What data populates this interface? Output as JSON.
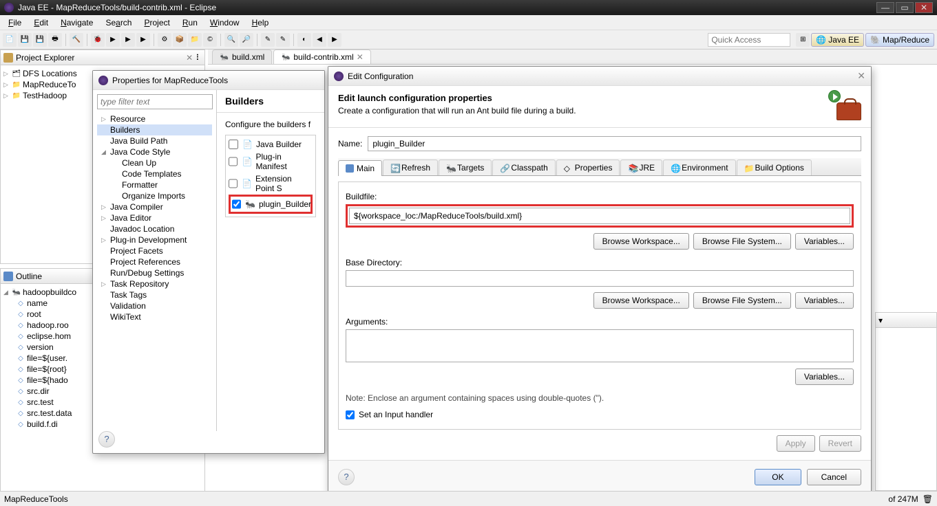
{
  "titlebar": {
    "text": "Java EE - MapReduceTools/build-contrib.xml - Eclipse"
  },
  "menu": {
    "file": "File",
    "edit": "Edit",
    "navigate": "Navigate",
    "search": "Search",
    "project": "Project",
    "run": "Run",
    "window": "Window",
    "help": "Help"
  },
  "quick_access": "Quick Access",
  "perspectives": {
    "java_ee": "Java EE",
    "mapreduce": "Map/Reduce"
  },
  "views": {
    "project_explorer": {
      "title": "Project Explorer",
      "items": [
        "DFS Locations",
        "MapReduceTo",
        "TestHadoop"
      ]
    },
    "outline": {
      "title": "Outline",
      "root": "hadoopbuildco",
      "items": [
        "name",
        "root",
        "hadoop.roo",
        "eclipse.hom",
        "version",
        "file=${user.",
        "file=${root}",
        "file=${hado",
        "src.dir",
        "src.test",
        "src.test.data",
        "build.f.di"
      ]
    }
  },
  "editor_tabs": {
    "t0": "build.xml",
    "t1": "build-contrib.xml"
  },
  "props_dialog": {
    "title": "Properties for MapReduceTools",
    "filter_placeholder": "type filter text",
    "tree": {
      "resource": "Resource",
      "builders": "Builders",
      "java_build_path": "Java Build Path",
      "java_code_style": "Java Code Style",
      "clean_up": "Clean Up",
      "code_templates": "Code Templates",
      "formatter": "Formatter",
      "organize": "Organize Imports",
      "java_compiler": "Java Compiler",
      "java_editor": "Java Editor",
      "javadoc": "Javadoc Location",
      "plugin_dev": "Plug-in Development",
      "facets": "Project Facets",
      "refs": "Project References",
      "run_debug": "Run/Debug Settings",
      "task_repo": "Task Repository",
      "task_tags": "Task Tags",
      "validation": "Validation",
      "wikitext": "WikiText"
    },
    "panel_title": "Builders",
    "panel_desc": "Configure the builders f",
    "builders": {
      "b0": "Java Builder",
      "b1": "Plug-in Manifest",
      "b2": "Extension Point S",
      "b3": "plugin_Builder"
    }
  },
  "edit_conf": {
    "title": "Edit Configuration",
    "head1": "Edit launch configuration properties",
    "head2": "Create a configuration that will run an Ant build file during a build.",
    "name_label": "Name:",
    "name_value": "plugin_Builder",
    "tabs": {
      "main": "Main",
      "refresh": "Refresh",
      "targets": "Targets",
      "classpath": "Classpath",
      "properties": "Properties",
      "jre": "JRE",
      "environment": "Environment",
      "build_options": "Build Options"
    },
    "buildfile_label": "Buildfile:",
    "buildfile_value": "${workspace_loc:/MapReduceTools/build.xml}",
    "browse_ws": "Browse Workspace...",
    "browse_fs": "Browse File System...",
    "variables": "Variables...",
    "basedir_label": "Base Directory:",
    "basedir_value": "",
    "args_label": "Arguments:",
    "args_value": "",
    "note": "Note: Enclose an argument containing spaces using double-quotes (\").",
    "input_handler": "Set an Input handler",
    "apply": "Apply",
    "revert": "Revert",
    "ok": "OK",
    "cancel": "Cancel"
  },
  "status": {
    "left": "MapReduceTools",
    "right": "of 247M"
  }
}
